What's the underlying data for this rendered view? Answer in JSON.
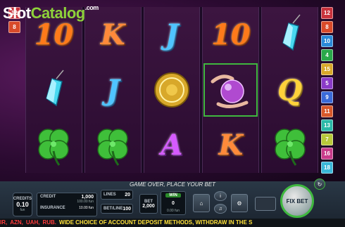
{
  "brand": {
    "part1": "Slot",
    "part2": "Catalog",
    "part3": ".com"
  },
  "paylines": {
    "left": [
      {
        "n": "12",
        "color": "#c8323c"
      },
      {
        "n": "8",
        "color": "#d84a2a"
      },
      {
        "n": "",
        "color": ""
      },
      {
        "n": "",
        "color": ""
      },
      {
        "n": "",
        "color": ""
      },
      {
        "n": "",
        "color": ""
      },
      {
        "n": "",
        "color": ""
      },
      {
        "n": "",
        "color": ""
      },
      {
        "n": "",
        "color": ""
      },
      {
        "n": "",
        "color": ""
      },
      {
        "n": "",
        "color": ""
      },
      {
        "n": "",
        "color": ""
      }
    ],
    "right": [
      {
        "n": "12",
        "color": "#c8323c"
      },
      {
        "n": "8",
        "color": "#d84a2a"
      },
      {
        "n": "10",
        "color": "#2a8ad8"
      },
      {
        "n": "4",
        "color": "#2aa84a"
      },
      {
        "n": "15",
        "color": "#d8a82a"
      },
      {
        "n": "5",
        "color": "#8a3ac8"
      },
      {
        "n": "9",
        "color": "#3a6ad8"
      },
      {
        "n": "11",
        "color": "#d8582a"
      },
      {
        "n": "13",
        "color": "#2ab8a8"
      },
      {
        "n": "7",
        "color": "#b8c83a"
      },
      {
        "n": "16",
        "color": "#c83a8a"
      },
      {
        "n": "18",
        "color": "#3ab8d8"
      }
    ]
  },
  "reels": [
    [
      {
        "sym": "10",
        "kind": "ten"
      },
      {
        "sym": "pendant",
        "kind": "pendant"
      },
      {
        "sym": "clover",
        "kind": "clover"
      }
    ],
    [
      {
        "sym": "K",
        "kind": "k"
      },
      {
        "sym": "J",
        "kind": "j"
      },
      {
        "sym": "clover",
        "kind": "clover"
      }
    ],
    [
      {
        "sym": "J",
        "kind": "j"
      },
      {
        "sym": "coin",
        "kind": "coin"
      },
      {
        "sym": "A",
        "kind": "a"
      }
    ],
    [
      {
        "sym": "10",
        "kind": "ten"
      },
      {
        "sym": "crystal ball",
        "kind": "ball"
      },
      {
        "sym": "K",
        "kind": "k"
      }
    ],
    [
      {
        "sym": "pendant",
        "kind": "pendant"
      },
      {
        "sym": "Q",
        "kind": "q"
      },
      {
        "sym": "clover",
        "kind": "clover"
      }
    ]
  ],
  "status_text": "GAME OVER, PLACE YOUR BET",
  "panel": {
    "denom_label": "CREDITS",
    "denom_value": "0.10",
    "denom_unit": "fun",
    "credit_label": "CREDIT",
    "credit_value": "1,000",
    "credit_sub": "100.00 fun",
    "insurance_label": "INSURANCE",
    "insurance_value": "10.00 fun",
    "lines_label": "LINES",
    "lines_value": "20",
    "betline_label": "BET/LINE",
    "betline_value": "100",
    "bet_label": "BET",
    "bet_value": "2,000",
    "win_label": "WIN",
    "win_value": "0",
    "win_sub": "0.00 fun",
    "fix_bet_label": "FIX BET"
  },
  "ticker": [
    {
      "text": "IR,",
      "color": "#ff3a3a"
    },
    {
      "text": "AZN,",
      "color": "#ff3a3a"
    },
    {
      "text": "UAH,",
      "color": "#ff3a3a"
    },
    {
      "text": "RUB.",
      "color": "#ff3a3a"
    },
    {
      "text": "WIDE CHOICE OF ACCOUNT DEPOSIT METHODS, WITHDRAW IN THE S",
      "color": "#ffe23a"
    }
  ]
}
